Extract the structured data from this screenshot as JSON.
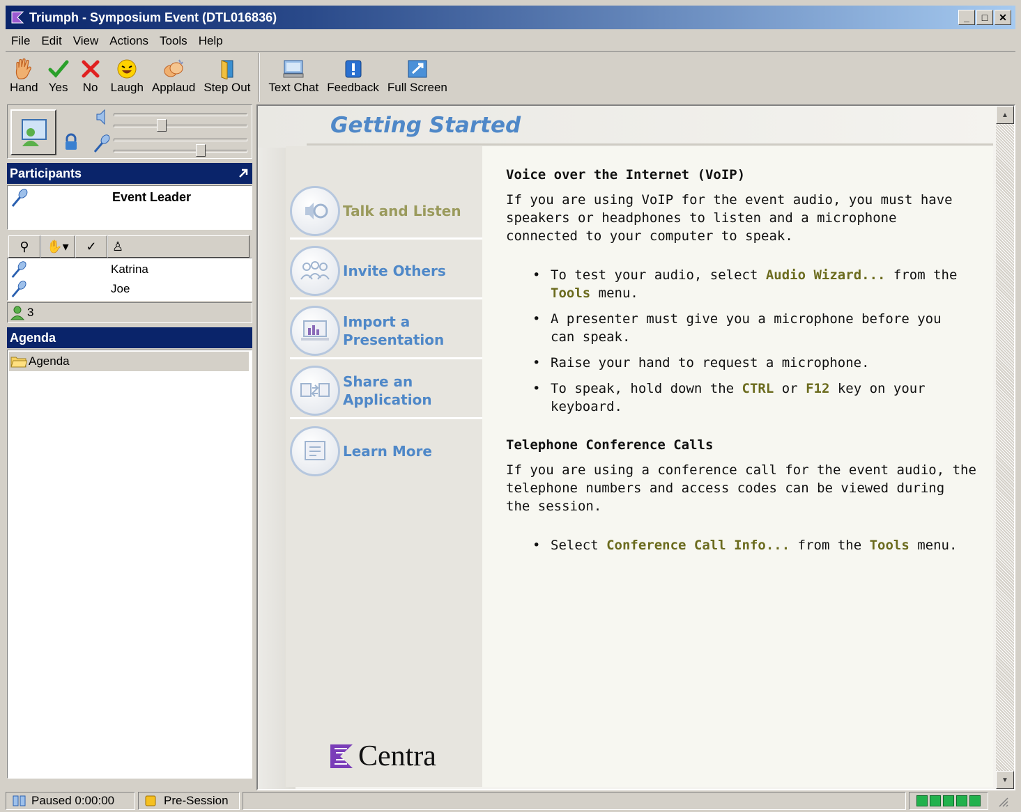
{
  "window": {
    "title": "Triumph - Symposium Event (DTL016836)",
    "buttons": {
      "minimize": "_",
      "maximize": "□",
      "close": "✕"
    }
  },
  "menu": [
    "File",
    "Edit",
    "View",
    "Actions",
    "Tools",
    "Help"
  ],
  "toolbar": {
    "group1": [
      {
        "label": "Hand",
        "icon": "hand-icon"
      },
      {
        "label": "Yes",
        "icon": "check-icon"
      },
      {
        "label": "No",
        "icon": "x-icon"
      },
      {
        "label": "Laugh",
        "icon": "laugh-icon"
      },
      {
        "label": "Applaud",
        "icon": "applaud-icon"
      },
      {
        "label": "Step Out",
        "icon": "step-out-icon"
      }
    ],
    "group2": [
      {
        "label": "Text Chat",
        "icon": "text-chat-icon"
      },
      {
        "label": "Feedback",
        "icon": "feedback-icon"
      },
      {
        "label": "Full Screen",
        "icon": "full-screen-icon"
      }
    ]
  },
  "participants": {
    "header": "Participants",
    "leader": "Event Leader",
    "members": [
      "Katrina",
      "Joe"
    ],
    "count": "3"
  },
  "agenda": {
    "header": "Agenda",
    "items": [
      "Agenda"
    ]
  },
  "getting_started": {
    "title": "Getting Started",
    "nav": [
      {
        "line1": "Talk and Listen",
        "line2": "",
        "active": true
      },
      {
        "line1": "Invite Others",
        "line2": "",
        "active": false
      },
      {
        "line1": "Import a",
        "line2": "Presentation",
        "active": false
      },
      {
        "line1": "Share an",
        "line2": "Application",
        "active": false
      },
      {
        "line1": "Learn More",
        "line2": "",
        "active": false
      }
    ],
    "logo": "Centra",
    "voip_heading": "Voice over the Internet (VoIP)",
    "voip_intro_1": "If you are using VoIP for the event audio, you must have",
    "voip_intro_2": "speakers or headphones to listen and a microphone",
    "voip_intro_3": "connected to your computer to speak.",
    "b1_a": "To test your audio, select ",
    "b1_hl1": "Audio Wizard...",
    "b1_b": " from the",
    "b1_hl2": "Tools",
    "b1_c": " menu.",
    "b2_1": "A presenter must give you a microphone before you",
    "b2_2": "can speak.",
    "b3": "Raise your hand to request a microphone.",
    "b4_a": "To speak, hold down the ",
    "b4_hl1": "CTRL",
    "b4_b": " or ",
    "b4_hl2": "F12",
    "b4_c": " key on your",
    "b4_d": "keyboard.",
    "tel_heading": "Telephone Conference Calls",
    "tel_intro_1": "If you are using a conference call for the event audio, the",
    "tel_intro_2": "telephone numbers and access codes can be viewed during",
    "tel_intro_3": "the session.",
    "b5_a": "Select ",
    "b5_hl1": "Conference Call Info...",
    "b5_b": " from the ",
    "b5_hl2": "Tools",
    "b5_c": " menu."
  },
  "status": {
    "paused": "Paused 0:00:00",
    "session": "Pre-Session"
  },
  "colors": {
    "accent": "#4f88c8",
    "highlight": "#6b6b1e",
    "titlebar": "#0a246a"
  }
}
